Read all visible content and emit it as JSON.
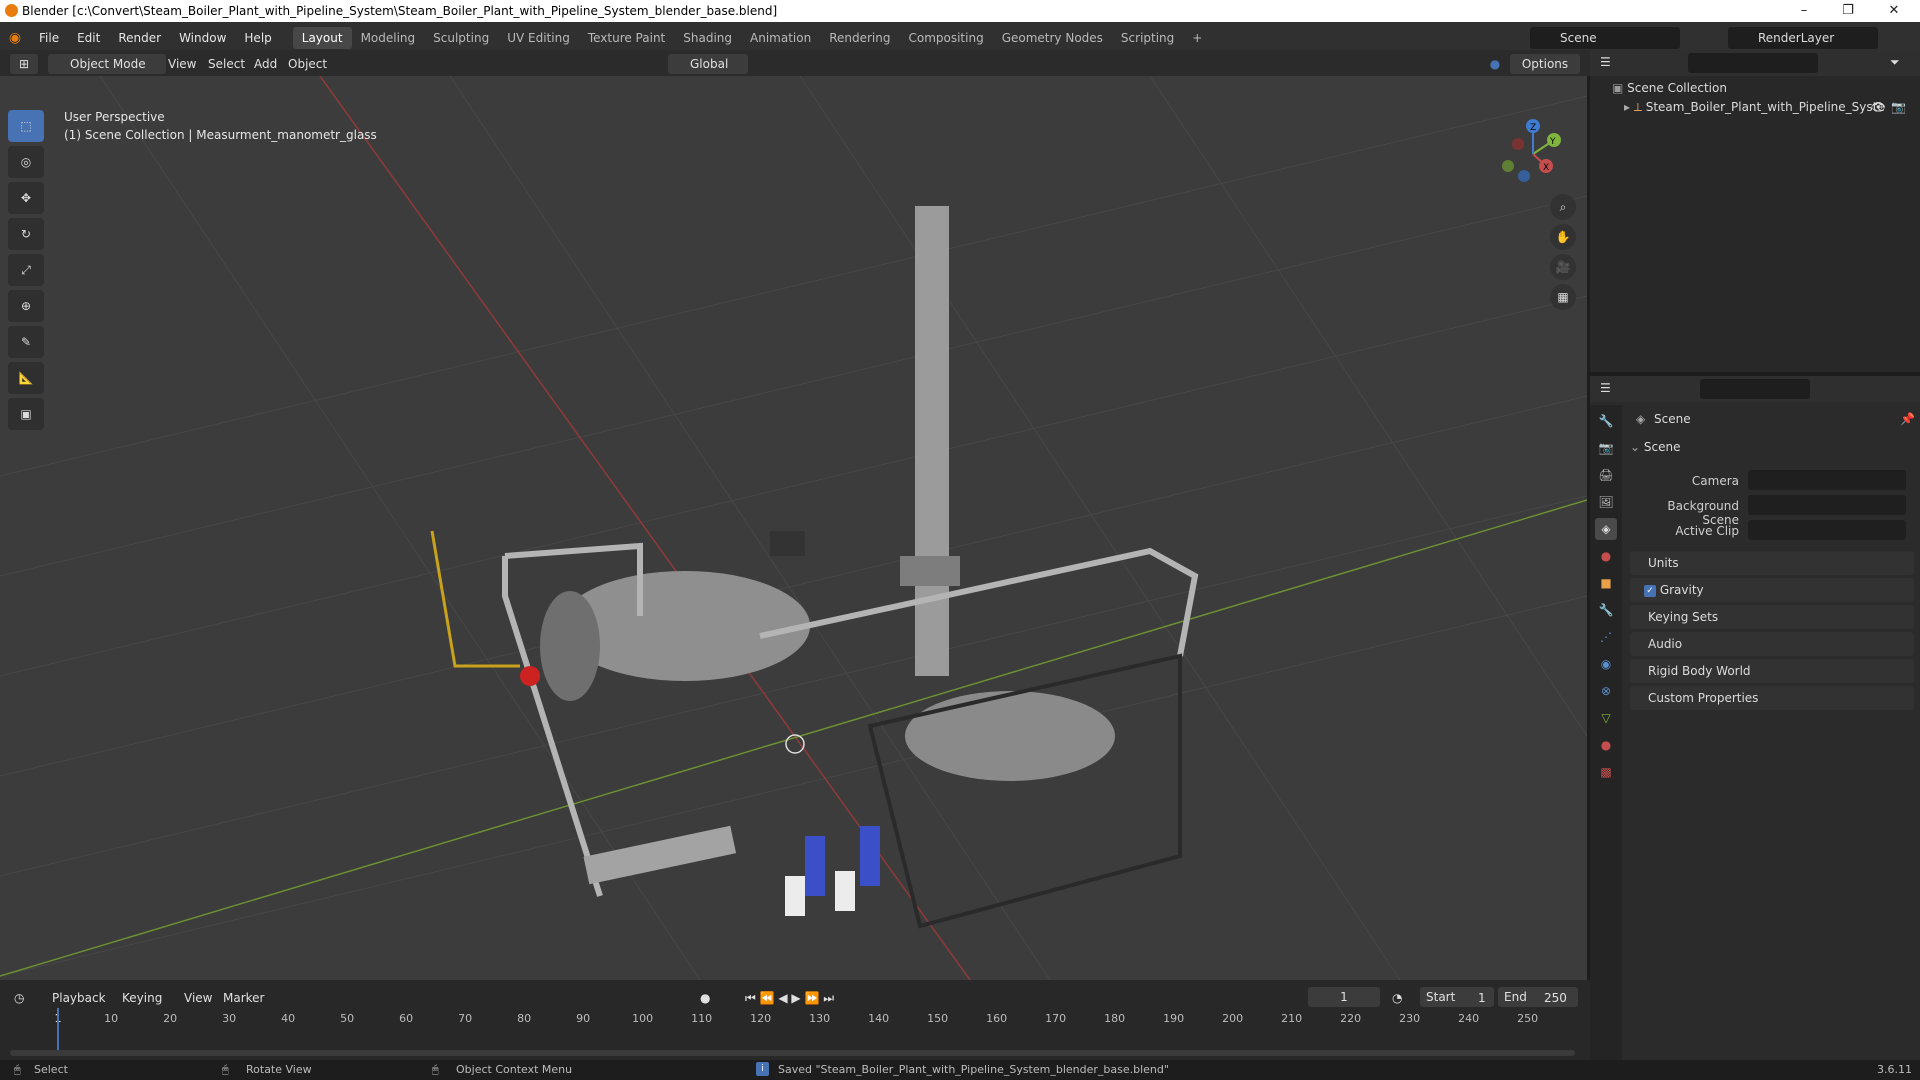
{
  "window": {
    "title": "Blender [c:\\Convert\\Steam_Boiler_Plant_with_Pipeline_System\\Steam_Boiler_Plant_with_Pipeline_System_blender_base.blend]"
  },
  "menus": [
    "File",
    "Edit",
    "Render",
    "Window",
    "Help"
  ],
  "workspaces": [
    "Layout",
    "Modeling",
    "Sculpting",
    "UV Editing",
    "Texture Paint",
    "Shading",
    "Animation",
    "Rendering",
    "Compositing",
    "Geometry Nodes",
    "Scripting"
  ],
  "active_workspace": "Layout",
  "scene": {
    "name": "Scene",
    "render_layer": "RenderLayer"
  },
  "viewport_header": {
    "mode": "Object Mode",
    "view": "View",
    "select": "Select",
    "add": "Add",
    "object": "Object",
    "orientation": "Global",
    "options": "Options"
  },
  "viewport": {
    "perspective": "User Perspective",
    "collection_info": "(1) Scene Collection | Measurment_manometr_glass",
    "gizmo_axes": {
      "x": "X",
      "y": "Y",
      "z": "Z"
    }
  },
  "outliner": {
    "root": "Scene Collection",
    "items": [
      {
        "name": "Steam_Boiler_Plant_with_Pipeline_Syste"
      }
    ]
  },
  "properties": {
    "header_title": "Scene",
    "section": "Scene",
    "fields": [
      {
        "label": "Camera"
      },
      {
        "label": "Background Scene"
      },
      {
        "label": "Active Clip"
      }
    ],
    "panels": [
      "Units",
      "Gravity",
      "Keying Sets",
      "Audio",
      "Rigid Body World",
      "Custom Properties"
    ],
    "gravity_checked": true
  },
  "timeline": {
    "playback": "Playback",
    "keying": "Keying",
    "view": "View",
    "marker": "Marker",
    "current_frame": "1",
    "start_label": "Start",
    "start": "1",
    "end_label": "End",
    "end": "250",
    "ticks": [
      "1",
      "10",
      "20",
      "30",
      "40",
      "50",
      "60",
      "70",
      "80",
      "90",
      "100",
      "110",
      "120",
      "130",
      "140",
      "150",
      "160",
      "170",
      "180",
      "190",
      "200",
      "210",
      "220",
      "230",
      "240",
      "250"
    ]
  },
  "statusbar": {
    "select": "Select",
    "rotate": "Rotate View",
    "context": "Object Context Menu",
    "message": "Saved \"Steam_Boiler_Plant_with_Pipeline_System_blender_base.blend\"",
    "version": "3.6.11"
  },
  "colors": {
    "accent": "#4772b3",
    "x_axis": "#c44d4d",
    "y_axis": "#80b43c",
    "z_axis": "#3d7cd1"
  }
}
